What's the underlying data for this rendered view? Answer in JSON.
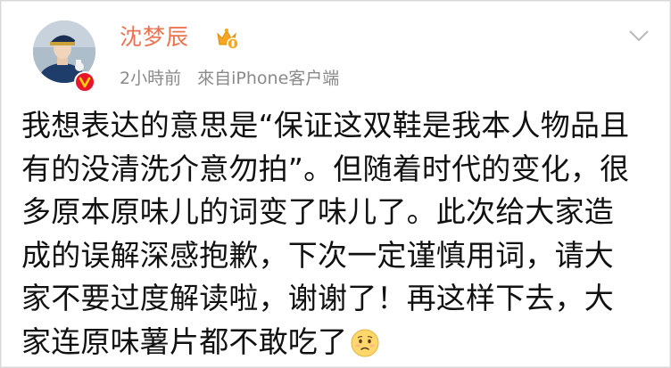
{
  "post": {
    "author": {
      "name": "沈梦辰"
    },
    "meta": {
      "time": "2小時前",
      "source": "來自iPhone客户端"
    },
    "body_lines": [
      "我想表达的意思是“保证这双鞋是我本人物品且",
      "有的没清洗介意勿拍”。但随着时代的变化，很",
      "多原本原味儿的词变了味儿了。此次给大家造",
      "成的误解深感抱歉，下次一定谨慎用词，请大",
      "家不要过度解读啦，谢谢了！再这样下去，大",
      "家连原味薯片都不敢吃了"
    ],
    "icons": {
      "avatar": "avatar",
      "verified": "verified-badge-icon",
      "crown": "vip-crown-icon",
      "menu": "chevron-down-icon",
      "emoji": "sad-face-emoji-icon"
    },
    "colors": {
      "name": "#eb7350",
      "meta": "#8a8a8a",
      "verified": "#e6162d",
      "crown": "#f5a623"
    }
  }
}
